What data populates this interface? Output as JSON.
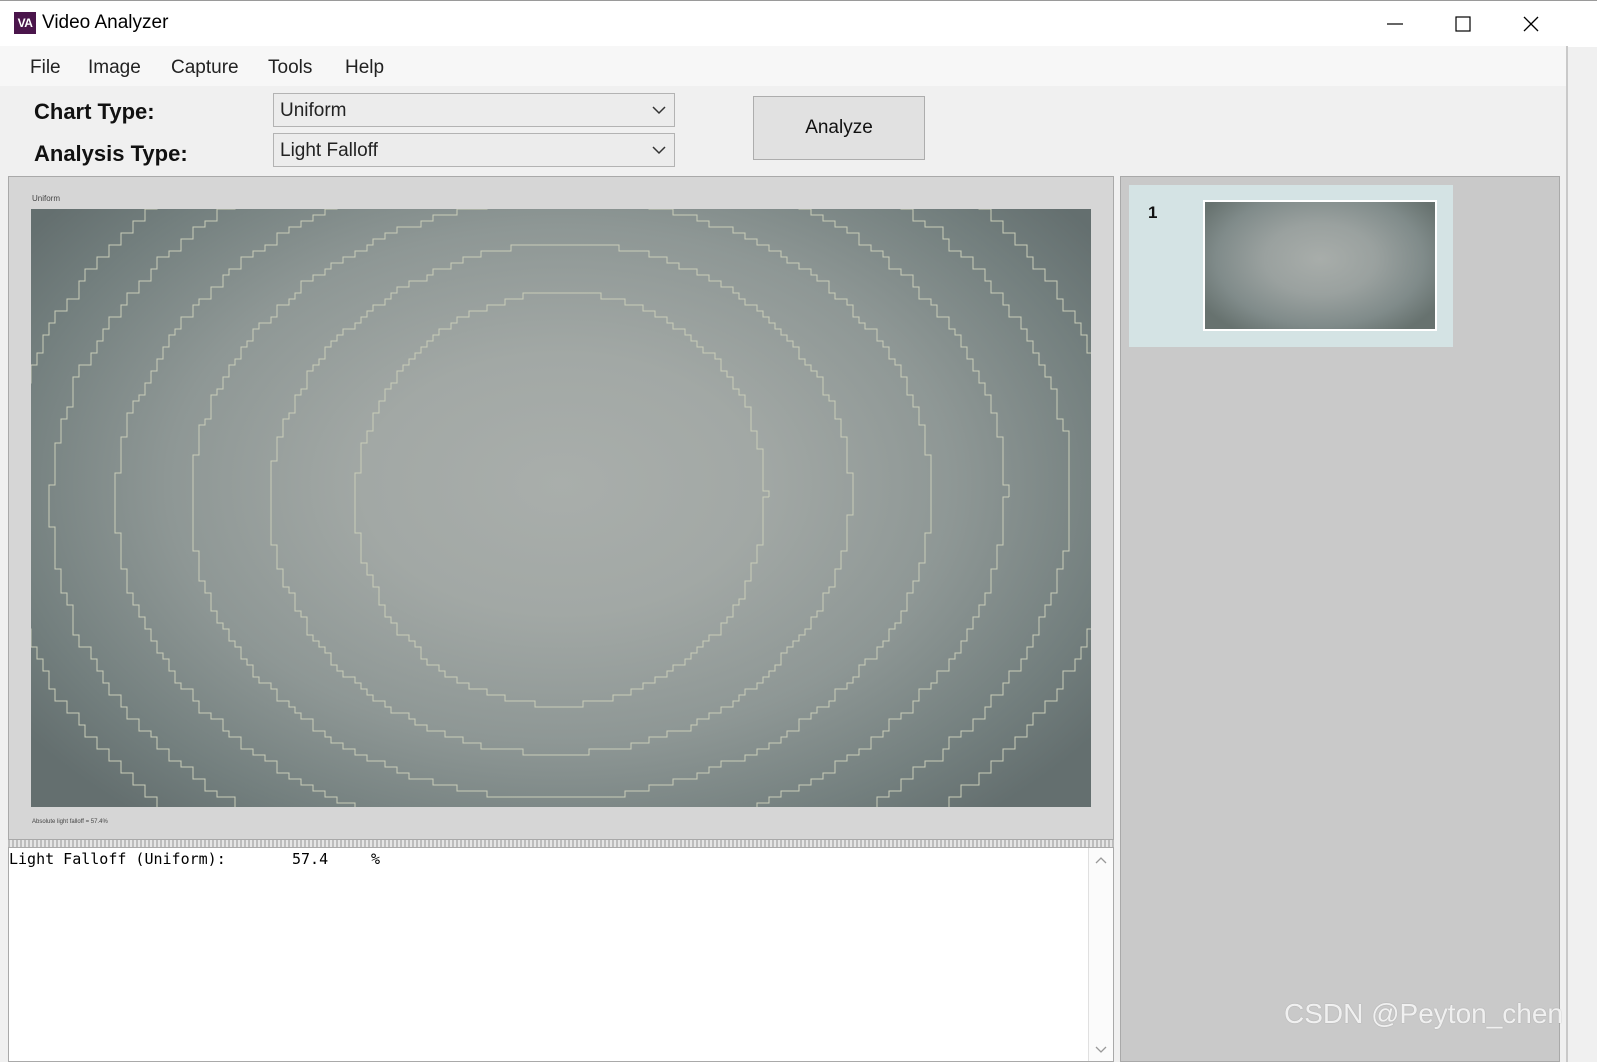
{
  "window": {
    "icon_text": "VA",
    "title": "Video Analyzer"
  },
  "menu": {
    "items": [
      {
        "label": "File"
      },
      {
        "label": "Image"
      },
      {
        "label": "Capture"
      },
      {
        "label": "Tools"
      },
      {
        "label": "Help"
      }
    ]
  },
  "controls": {
    "chart_type_label": "Chart Type:",
    "chart_type_value": "Uniform",
    "analysis_type_label": "Analysis Type:",
    "analysis_type_value": "Light Falloff",
    "analyze_label": "Analyze"
  },
  "image_panel": {
    "caption_top": "Uniform",
    "caption_bottom": "Absolute light falloff = 57.4%",
    "contour_color": "#c9cdb8"
  },
  "output": {
    "label": "Light Falloff (Uniform):",
    "value": "57.4",
    "unit": "%"
  },
  "thumbnails": [
    {
      "index": "1"
    }
  ],
  "watermark": "CSDN @Peyton_chen"
}
